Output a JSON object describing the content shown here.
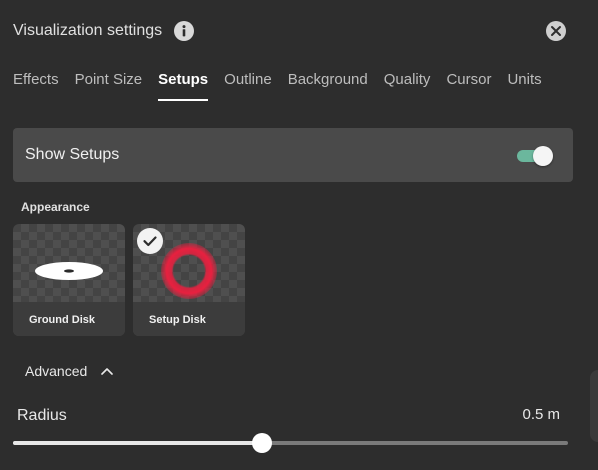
{
  "header": {
    "title": "Visualization settings"
  },
  "tabs": [
    {
      "label": "Effects",
      "active": false
    },
    {
      "label": "Point Size",
      "active": false
    },
    {
      "label": "Setups",
      "active": true
    },
    {
      "label": "Outline",
      "active": false
    },
    {
      "label": "Background",
      "active": false
    },
    {
      "label": "Quality",
      "active": false
    },
    {
      "label": "Cursor",
      "active": false
    },
    {
      "label": "Units",
      "active": false
    }
  ],
  "show_setups": {
    "label": "Show Setups",
    "enabled": true,
    "toggle_color": "#6bb79d"
  },
  "appearance": {
    "label": "Appearance",
    "options": [
      {
        "label": "Ground Disk",
        "selected": false,
        "icon": "ground-disk-icon"
      },
      {
        "label": "Setup Disk",
        "selected": true,
        "icon": "setup-disk-icon",
        "accent": "#e8203f"
      }
    ]
  },
  "advanced": {
    "label": "Advanced",
    "expanded": true
  },
  "radius": {
    "label": "Radius",
    "value_text": "0.5 m",
    "slider_fraction": 0.448
  }
}
